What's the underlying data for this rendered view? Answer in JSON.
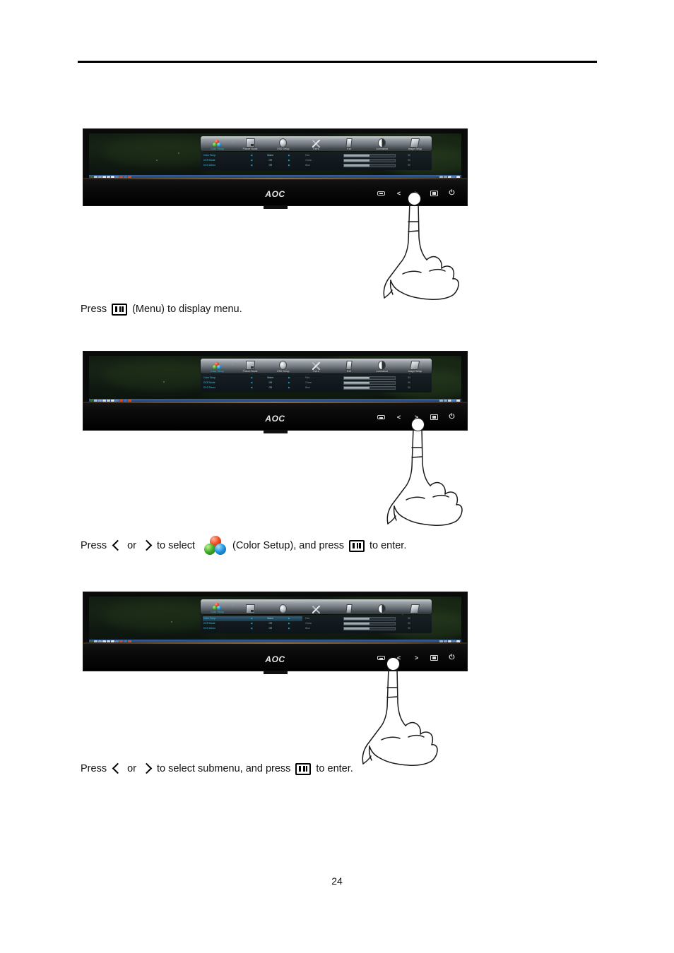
{
  "page": {
    "number": "24"
  },
  "monitor": {
    "brand": "AOC",
    "buttons": [
      {
        "name": "source",
        "label": ""
      },
      {
        "name": "left",
        "label": "<"
      },
      {
        "name": "right",
        "label": ">"
      },
      {
        "name": "menu",
        "label": ""
      },
      {
        "name": "power",
        "label": "⏻"
      }
    ]
  },
  "osd": {
    "tabs": [
      {
        "label": "Color Setup",
        "icon": "color-balls-icon"
      },
      {
        "label": "Picture Boost",
        "icon": "picture-boost-icon"
      },
      {
        "label": "OSD Setup",
        "icon": "osd-setup-icon"
      },
      {
        "label": "Extra",
        "icon": "extra-tools-icon"
      },
      {
        "label": "Exit",
        "icon": "exit-door-icon"
      },
      {
        "label": "Luminance",
        "icon": "luminance-icon"
      },
      {
        "label": "Image Setup",
        "icon": "image-setup-icon"
      }
    ],
    "active_tab_index": 0,
    "arrow_left": "‹",
    "arrow_right": "›",
    "rows": [
      {
        "label": "Color Temp.",
        "value": "Warm",
        "arrow_left": "◀",
        "arrow_right": "▶"
      },
      {
        "label": "DCR Mode",
        "value": "Off",
        "arrow_left": "◀",
        "arrow_right": "▶"
      },
      {
        "label": "ECO Demo",
        "value": "Off",
        "arrow_left": "◀",
        "arrow_right": "▶"
      }
    ],
    "rgb_rows": [
      {
        "label": "Red",
        "value": "50",
        "percent": 50
      },
      {
        "label": "Green",
        "value": "50",
        "percent": 50
      },
      {
        "label": "Blue",
        "value": "50",
        "percent": 50
      }
    ],
    "highlight_row_index_step3": 0
  },
  "steps": [
    {
      "id": "step-1",
      "caption_prefix": "Press",
      "caption_middle": "(Menu) to display menu.",
      "glyph": "menu-glyph",
      "pressed_button": "menu"
    },
    {
      "id": "step-2",
      "caption_prefix": "Press",
      "caption_or": "or",
      "caption_middle": "to select",
      "caption_paren": "(Color Setup), and press",
      "caption_suffix": "to enter.",
      "pressed_button": "menu"
    },
    {
      "id": "step-3",
      "caption_prefix": "Press",
      "caption_or": "or",
      "caption_middle": "to select submenu, and press",
      "caption_suffix": "to enter.",
      "pressed_button": "left-right"
    }
  ]
}
